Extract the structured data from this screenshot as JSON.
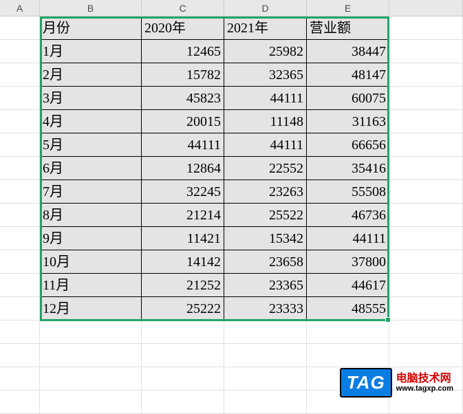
{
  "columns": [
    "A",
    "B",
    "C",
    "D",
    "E"
  ],
  "table": {
    "headers": [
      "月份",
      "2020年",
      "2021年",
      "营业额"
    ],
    "rows": [
      {
        "month": "1月",
        "y2020": "12465",
        "y2021": "25982",
        "rev": "38447"
      },
      {
        "month": "2月",
        "y2020": "15782",
        "y2021": "32365",
        "rev": "48147"
      },
      {
        "month": "3月",
        "y2020": "45823",
        "y2021": "44111",
        "rev": "60075"
      },
      {
        "month": "4月",
        "y2020": "20015",
        "y2021": "11148",
        "rev": "31163"
      },
      {
        "month": "5月",
        "y2020": "44111",
        "y2021": "44111",
        "rev": "66656"
      },
      {
        "month": "6月",
        "y2020": "12864",
        "y2021": "22552",
        "rev": "35416"
      },
      {
        "month": "7月",
        "y2020": "32245",
        "y2021": "23263",
        "rev": "55508"
      },
      {
        "month": "8月",
        "y2020": "21214",
        "y2021": "25522",
        "rev": "46736"
      },
      {
        "month": "9月",
        "y2020": "11421",
        "y2021": "15342",
        "rev": "44111"
      },
      {
        "month": "10月",
        "y2020": "14142",
        "y2021": "23658",
        "rev": "37800"
      },
      {
        "month": "11月",
        "y2020": "21252",
        "y2021": "23365",
        "rev": "44617"
      },
      {
        "month": "12月",
        "y2020": "25222",
        "y2021": "23333",
        "rev": "48555"
      }
    ]
  },
  "badge": {
    "tag": "TAG",
    "line1": "电脑技术网",
    "line2": "www.tagxp.com"
  }
}
